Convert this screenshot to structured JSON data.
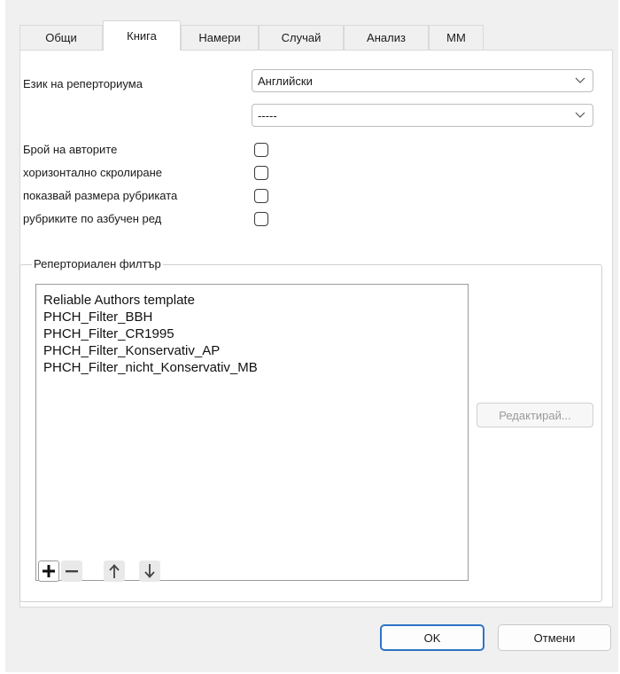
{
  "tabs": [
    {
      "label": "Общи"
    },
    {
      "label": "Книга"
    },
    {
      "label": "Намери"
    },
    {
      "label": "Случай"
    },
    {
      "label": "Анализ"
    },
    {
      "label": "MM"
    }
  ],
  "active_tab": "Книга",
  "language": {
    "label": "Език на реперториума",
    "value": "Английски",
    "secondary_value": "-----"
  },
  "options": [
    {
      "label": "Брой на авторите",
      "checked": false
    },
    {
      "label": "хоризонтално скролиране",
      "checked": false
    },
    {
      "label": "показвай размера рубриката",
      "checked": false
    },
    {
      "label": "рубриките по азбучен ред",
      "checked": false
    }
  ],
  "filter": {
    "title": "Реперториален филтър",
    "items": [
      "Reliable Authors template",
      "PHCH_Filter_BBH",
      "PHCH_Filter_CR1995",
      "PHCH_Filter_Konservativ_AP",
      "PHCH_Filter_nicht_Konservativ_MB"
    ],
    "edit_label": "Редактирай...",
    "toolbar": [
      "plus-icon",
      "minus-icon",
      "arrow-up-icon",
      "arrow-down-icon"
    ]
  },
  "footer": {
    "ok_label": "OK",
    "cancel_label": "Отмени"
  },
  "colors": {
    "accent": "#2f73c4",
    "background": "#f0f0f0"
  }
}
